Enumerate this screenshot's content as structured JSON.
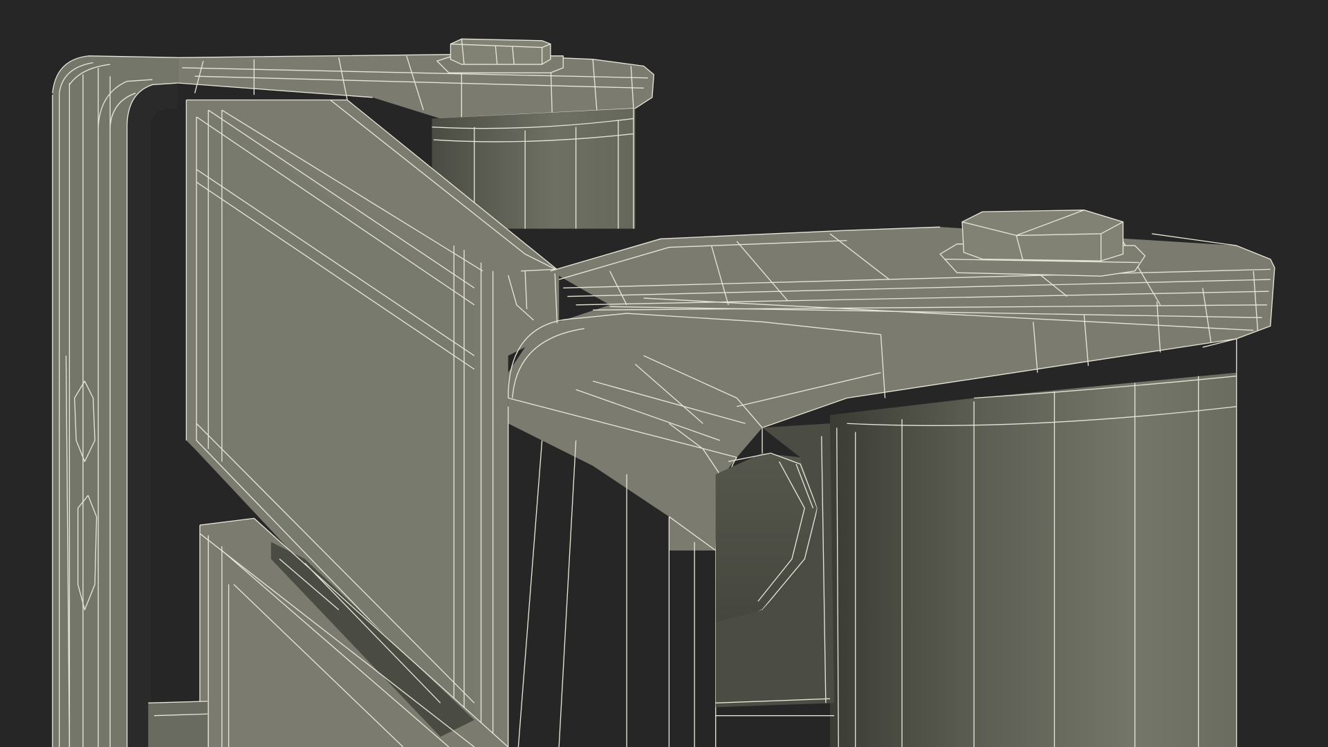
{
  "scene": {
    "background_color": "#262626",
    "surface_color": "#7b7c6f",
    "wireframe_color": "#e6e6d8",
    "subject": "wireframe-render"
  }
}
